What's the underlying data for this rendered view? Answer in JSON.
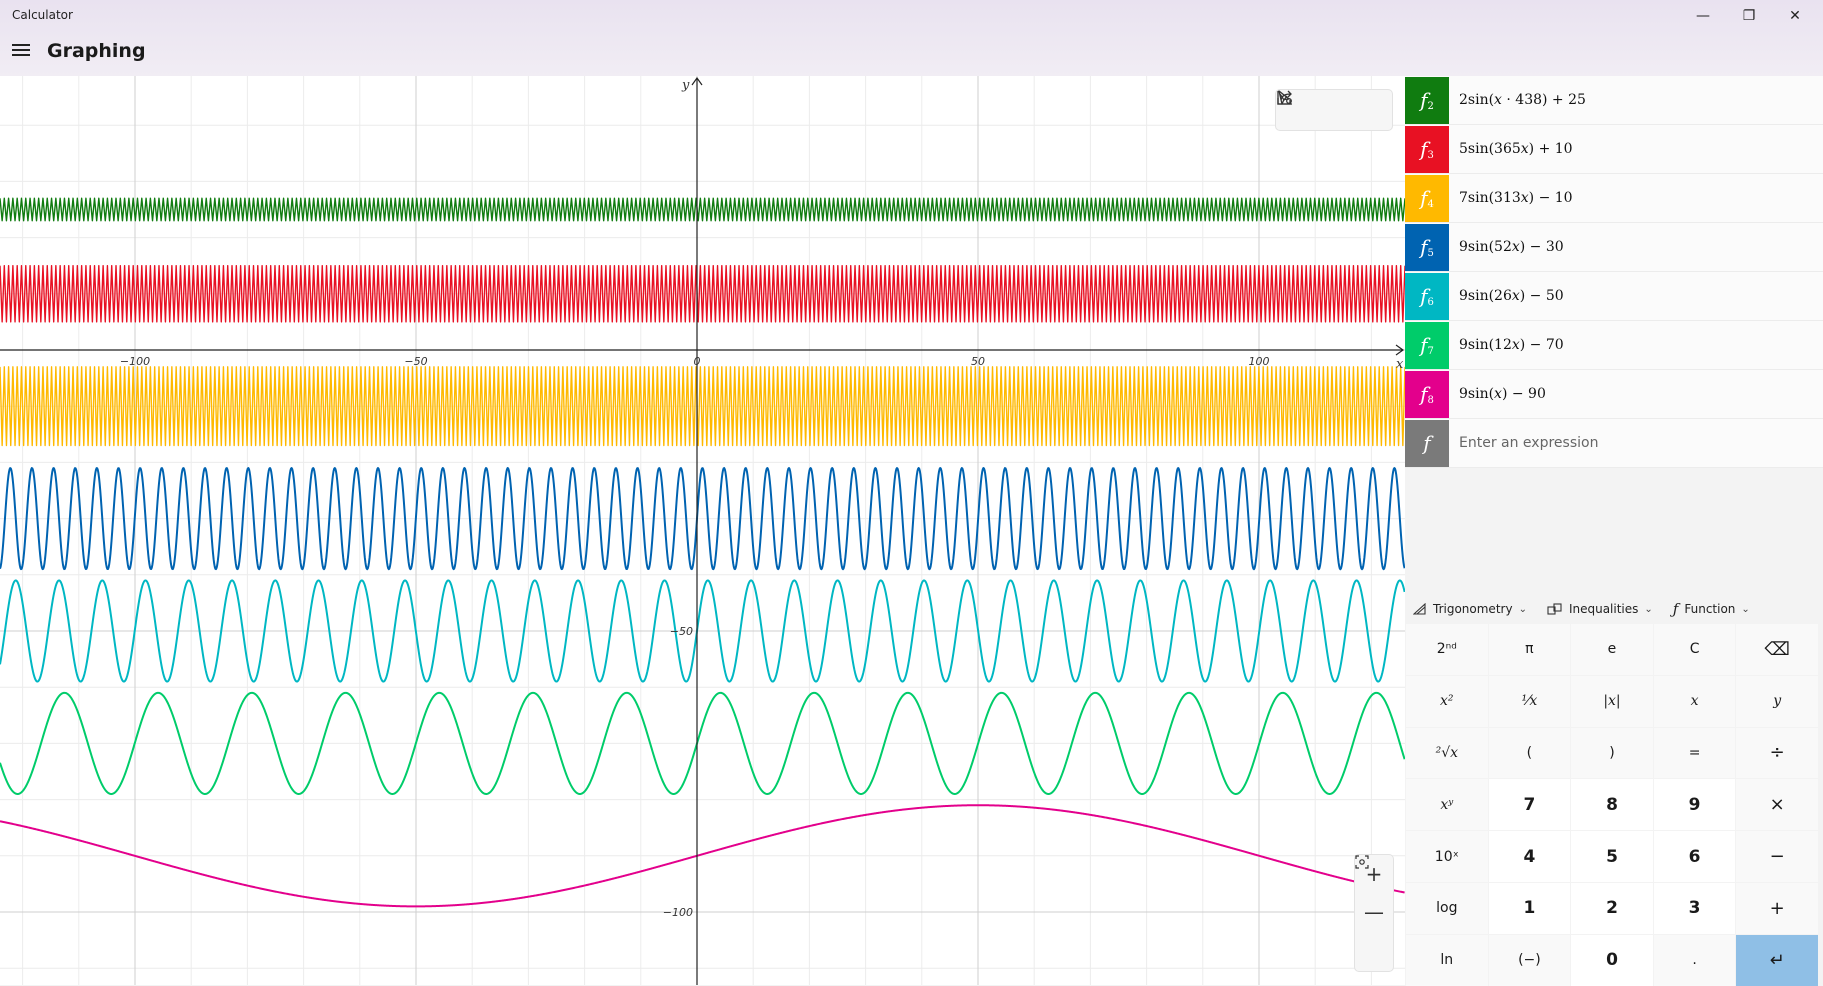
{
  "app": {
    "title": "Calculator",
    "mode": "Graphing"
  },
  "window_controls": {
    "minimize": "—",
    "restore": "❐",
    "close": "✕"
  },
  "graph": {
    "x_axis_label": "x",
    "y_axis_label": "y",
    "x_ticks": [
      "−100",
      "−50",
      "0",
      "50",
      "100"
    ],
    "y_ticks": [
      "−50",
      "−100"
    ],
    "grid": true
  },
  "graph_tools": {
    "trace": "trace-icon",
    "share": "share-icon",
    "settings": "graph-settings-icon"
  },
  "zoom": {
    "zoom_in": "+",
    "zoom_out": "—",
    "reset": "reset-view-icon"
  },
  "functions": [
    {
      "id": "2",
      "label": "f",
      "expr": "2sin(𝑥 · 438) + 25",
      "color": "#107c10"
    },
    {
      "id": "3",
      "label": "f",
      "expr": "5sin(365𝑥) + 10",
      "color": "#e81123"
    },
    {
      "id": "4",
      "label": "f",
      "expr": "7sin(313𝑥) − 10",
      "color": "#ffb900"
    },
    {
      "id": "5",
      "label": "f",
      "expr": "9sin(52𝑥) − 30",
      "color": "#0063b1"
    },
    {
      "id": "6",
      "label": "f",
      "expr": "9sin(26𝑥) − 50",
      "color": "#00b7c3"
    },
    {
      "id": "7",
      "label": "f",
      "expr": "9sin(12𝑥) − 70",
      "color": "#00cc6a"
    },
    {
      "id": "8",
      "label": "f",
      "expr": "9sin(𝑥) − 90",
      "color": "#e3008c"
    }
  ],
  "new_function": {
    "label": "f",
    "placeholder": "Enter an expression",
    "color": "#7a7a7a"
  },
  "function_toolbar": [
    {
      "icon": "triangle-ruler-icon",
      "label": "Trigonometry"
    },
    {
      "icon": "inequality-icon",
      "label": "Inequalities"
    },
    {
      "icon": "function-icon",
      "label": "Function"
    }
  ],
  "keypad": [
    [
      "2ⁿᵈ",
      "π",
      "e",
      "C",
      "⌫"
    ],
    [
      "𝑥²",
      "¹⁄𝑥",
      "|𝑥|",
      "𝑥",
      "𝑦"
    ],
    [
      "²√𝑥",
      "(",
      ")",
      "=",
      "÷"
    ],
    [
      "𝑥ʸ",
      "7",
      "8",
      "9",
      "×"
    ],
    [
      "10ˣ",
      "4",
      "5",
      "6",
      "−"
    ],
    [
      "log",
      "1",
      "2",
      "3",
      "+"
    ],
    [
      "ln",
      "(−)",
      "0",
      ".",
      "↵"
    ]
  ]
}
